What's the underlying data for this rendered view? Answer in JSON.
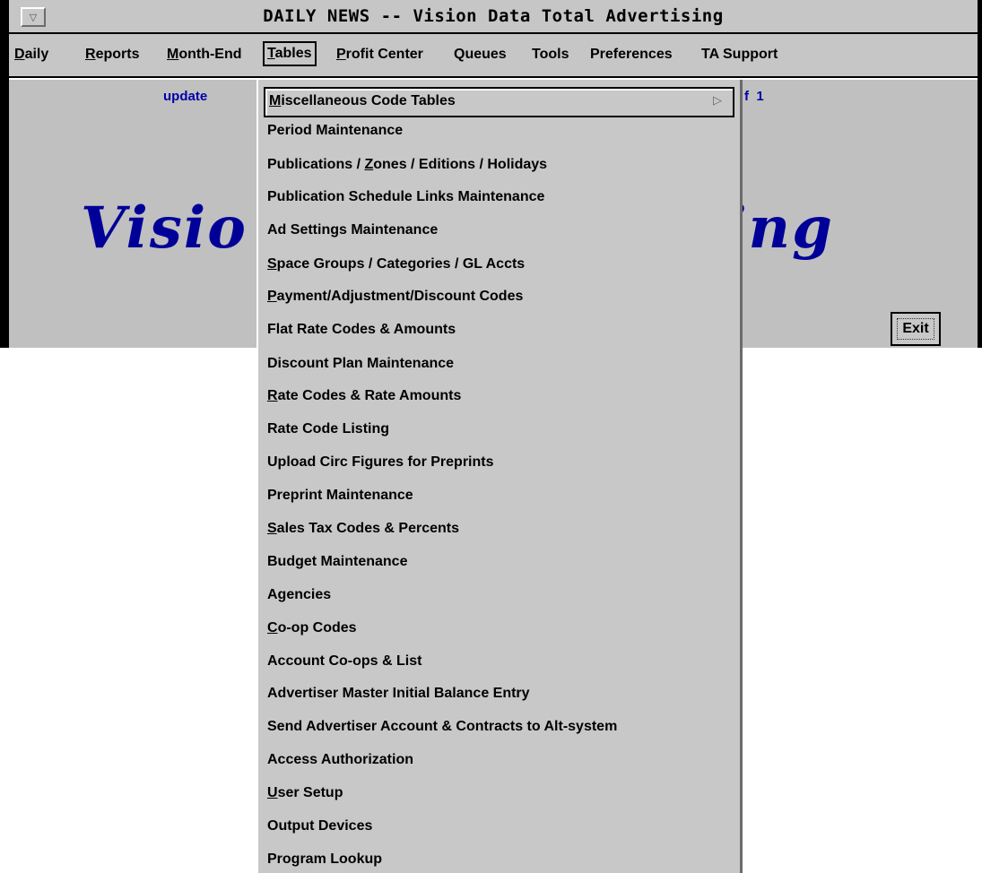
{
  "window": {
    "title": "DAILY NEWS -- Vision Data Total Advertising",
    "sysmenu_glyph": "▽"
  },
  "menubar": {
    "items": [
      {
        "label_u": "D",
        "label_rest": "aily"
      },
      {
        "label_u": "R",
        "label_rest": "eports"
      },
      {
        "label_u": "M",
        "label_rest": "onth-End"
      },
      {
        "label_u": "T",
        "label_rest": "ables"
      },
      {
        "label_u": "P",
        "label_rest": "rofit Center"
      },
      {
        "label_u": "",
        "label_rest": "Queues"
      },
      {
        "label_u": "",
        "label_rest": "Tools"
      },
      {
        "label_u": "",
        "label_rest": "Preferences"
      },
      {
        "label_u": "",
        "label_rest": "TA Support"
      }
    ],
    "active": "Tables"
  },
  "client": {
    "status": "update",
    "page_info": "f  1",
    "banner_left": "Visio",
    "banner_right": "ising",
    "exit_label": "Exit"
  },
  "dropdown": {
    "items": [
      {
        "u": "M",
        "rest": "iscellaneous Code Tables",
        "submenu": true
      },
      {
        "u": "",
        "rest": "Period Maintenance"
      },
      {
        "pre": "Publications / ",
        "u": "Z",
        "rest": "ones / Editions / Holidays"
      },
      {
        "u": "",
        "rest": "Publication Schedule Links Maintenance"
      },
      {
        "u": "",
        "rest": "Ad Settings Maintenance"
      },
      {
        "u": "S",
        "rest": "pace Groups / Categories / GL Accts"
      },
      {
        "u": "P",
        "rest": "ayment/Adjustment/Discount Codes"
      },
      {
        "u": "",
        "rest": "Flat Rate Codes & Amounts"
      },
      {
        "u": "",
        "rest": "Discount Plan Maintenance"
      },
      {
        "u": "R",
        "rest": "ate Codes & Rate Amounts"
      },
      {
        "u": "",
        "rest": "Rate Code Listing"
      },
      {
        "u": "",
        "rest": "Upload Circ Figures for Preprints"
      },
      {
        "u": "",
        "rest": "Preprint Maintenance"
      },
      {
        "u": "S",
        "rest": "ales Tax Codes & Percents"
      },
      {
        "u": "",
        "rest": "Budget Maintenance"
      },
      {
        "u": "",
        "rest": "Agencies"
      },
      {
        "u": "C",
        "rest": "o-op Codes"
      },
      {
        "u": "",
        "rest": "Account Co-ops & List"
      },
      {
        "u": "",
        "rest": "Advertiser Master Initial Balance Entry"
      },
      {
        "u": "",
        "rest": "Send Advertiser Account & Contracts to Alt-system"
      },
      {
        "u": "",
        "rest": "Access Authorization"
      },
      {
        "u": "U",
        "rest": "ser Setup"
      },
      {
        "u": "",
        "rest": "Output Devices"
      },
      {
        "u": "",
        "rest": "Program Lookup"
      }
    ],
    "submenu_arrow": "▷"
  }
}
